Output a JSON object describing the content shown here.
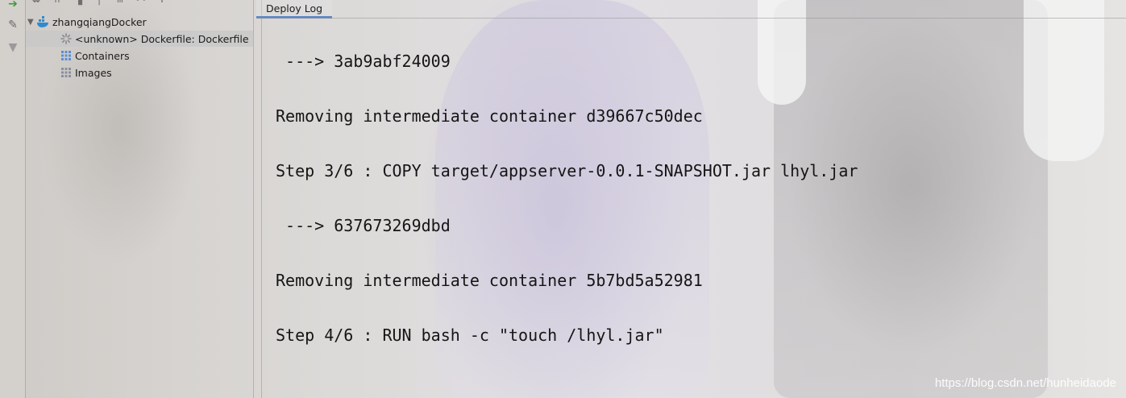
{
  "tree": {
    "root": {
      "label": "zhangqiangDocker",
      "icon": "docker-icon"
    },
    "items": [
      {
        "label": "<unknown> Dockerfile: Dockerfile",
        "icon": "loading-spinner-icon"
      },
      {
        "label": "Containers",
        "icon": "grid-icon"
      },
      {
        "label": "Images",
        "icon": "grid-icon"
      }
    ]
  },
  "tab": {
    "label": "Deploy Log"
  },
  "log": {
    "lines": [
      " ---> 3ab9abf24009",
      "Removing intermediate container d39667c50dec",
      "Step 3/6 : COPY target/appserver-0.0.1-SNAPSHOT.jar lhyl.jar",
      " ---> 637673269dbd",
      "Removing intermediate container 5b7bd5a52981",
      "Step 4/6 : RUN bash -c \"touch /lhyl.jar\""
    ]
  },
  "watermark": "https://blog.csdn.net/hunheidaode",
  "colors": {
    "accent": "#5f86c4",
    "docker": "#2f8bd0",
    "deploy": "#3f9a3a"
  }
}
